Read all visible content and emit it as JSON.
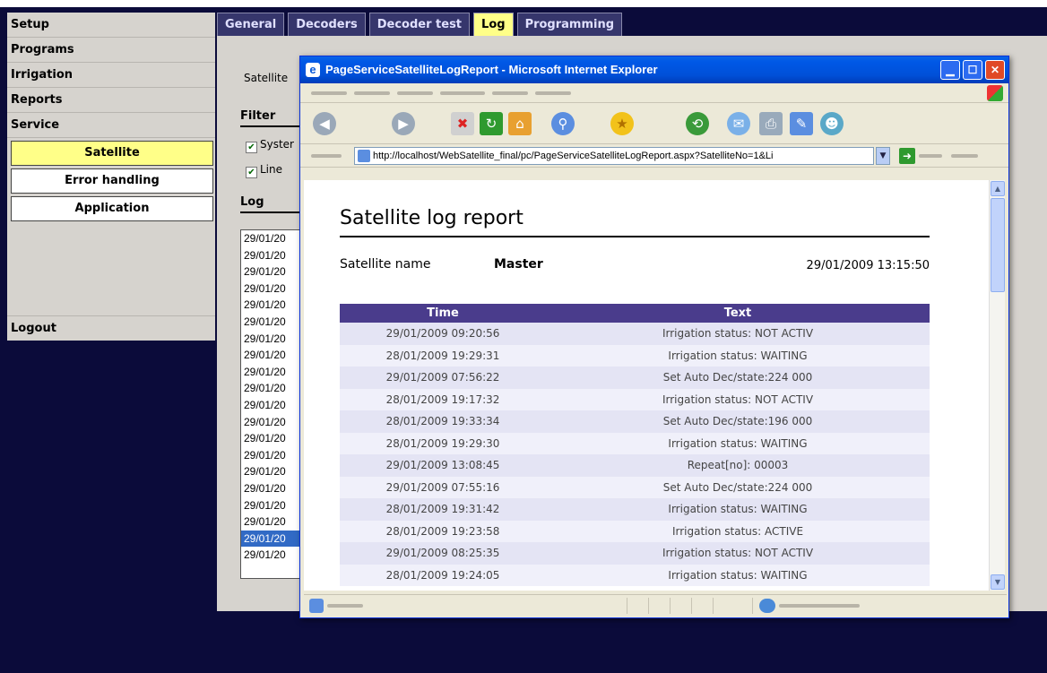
{
  "nav": {
    "items": [
      "Setup",
      "Programs",
      "Irrigation",
      "Reports",
      "Service"
    ],
    "subitems": [
      "Satellite",
      "Error handling",
      "Application"
    ],
    "logout": "Logout"
  },
  "tabs": [
    "General",
    "Decoders",
    "Decoder test",
    "Log",
    "Programming"
  ],
  "panel": {
    "satellite_label": "Satellite",
    "filter_label": "Filter",
    "checkbox1": "Syster",
    "checkbox2": "Line",
    "log_label": "Log",
    "log_rows": [
      "29/01/20",
      "29/01/20",
      "29/01/20",
      "29/01/20",
      "29/01/20",
      "29/01/20",
      "29/01/20",
      "29/01/20",
      "29/01/20",
      "29/01/20",
      "29/01/20",
      "29/01/20",
      "29/01/20",
      "29/01/20",
      "29/01/20",
      "29/01/20",
      "29/01/20",
      "29/01/20",
      "29/01/20",
      "29/01/20"
    ],
    "selected_log_index": 18
  },
  "browser": {
    "title": "PageServiceSatelliteLogReport - Microsoft Internet Explorer",
    "address": "http://localhost/WebSatellite_final/pc/PageServiceSatelliteLogReport.aspx?SatelliteNo=1&Li"
  },
  "report": {
    "title": "Satellite log report",
    "satellite_name_label": "Satellite name",
    "satellite_name": "Master",
    "date": "29/01/2009 13:15:50",
    "columns": [
      "Time",
      "Text"
    ],
    "rows": [
      [
        "29/01/2009 09:20:56",
        "Irrigation status: NOT ACTIV"
      ],
      [
        "28/01/2009 19:29:31",
        "Irrigation status: WAITING"
      ],
      [
        "29/01/2009 07:56:22",
        "Set Auto Dec/state:224 000"
      ],
      [
        "28/01/2009 19:17:32",
        "Irrigation status: NOT ACTIV"
      ],
      [
        "28/01/2009 19:33:34",
        "Set Auto Dec/state:196 000"
      ],
      [
        "28/01/2009 19:29:30",
        "Irrigation status: WAITING"
      ],
      [
        "29/01/2009 13:08:45",
        "Repeat[no]: 00003"
      ],
      [
        "29/01/2009 07:55:16",
        "Set Auto Dec/state:224 000"
      ],
      [
        "28/01/2009 19:31:42",
        "Irrigation status: WAITING"
      ],
      [
        "28/01/2009 19:23:58",
        "Irrigation status: ACTIVE"
      ],
      [
        "29/01/2009 08:25:35",
        "Irrigation status: NOT ACTIV"
      ],
      [
        "28/01/2009 19:24:05",
        "Irrigation status: WAITING"
      ]
    ]
  }
}
